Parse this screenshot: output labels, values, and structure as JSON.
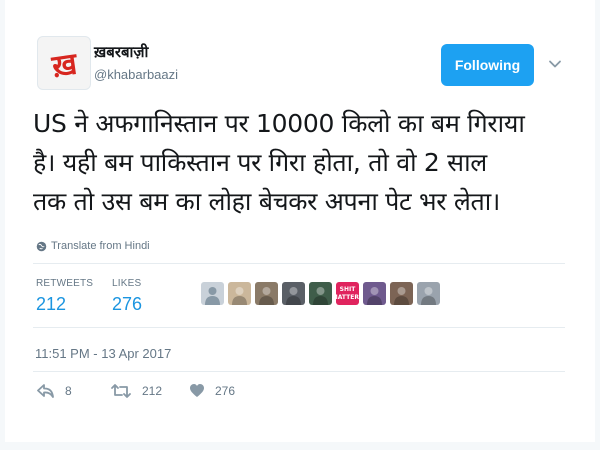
{
  "user": {
    "display_name": "ख़बरबाज़ी",
    "handle": "@khabarbaazi",
    "avatar_glyph": "ख़"
  },
  "follow_label": "Following",
  "tweet": {
    "lines": [
      "US ने अफगानिस्तान पर 10000 किलो का बम गिराया",
      "है। यही बम पाकिस्तान पर गिरा होता, तो वो 2 साल",
      "तक तो उस बम का लोहा बेचकर अपना पेट भर लेता।"
    ]
  },
  "translate_label": "Translate from Hindi",
  "stats": {
    "retweets_label": "RETWEETS",
    "retweets": "212",
    "likes_label": "LIKES",
    "likes": "276"
  },
  "likers": [
    {
      "icon": "default-avatar",
      "color": "#c9d1d9"
    },
    {
      "icon": "person-photo",
      "color": "#cbb79b"
    },
    {
      "icon": "sunset-photo",
      "color": "#8a7a67"
    },
    {
      "icon": "person-photo",
      "color": "#5a5f66"
    },
    {
      "icon": "person-photo",
      "color": "#3f5d4a"
    },
    {
      "icon": "text-badge",
      "color": "#e0245e",
      "line1": "SHIT",
      "line2": "MATTERS"
    },
    {
      "icon": "person-photo",
      "color": "#6f5a8e"
    },
    {
      "icon": "group-photo",
      "color": "#7c6455"
    },
    {
      "icon": "group-photo",
      "color": "#9aa3ad"
    }
  ],
  "timestamp": "11:51 PM - 13 Apr 2017",
  "actions": {
    "reply_count": "8",
    "retweet_count": "212",
    "like_count": "276"
  },
  "colors": {
    "accent": "#1da1f2",
    "link": "#1b95e0",
    "muted": "#657786"
  }
}
